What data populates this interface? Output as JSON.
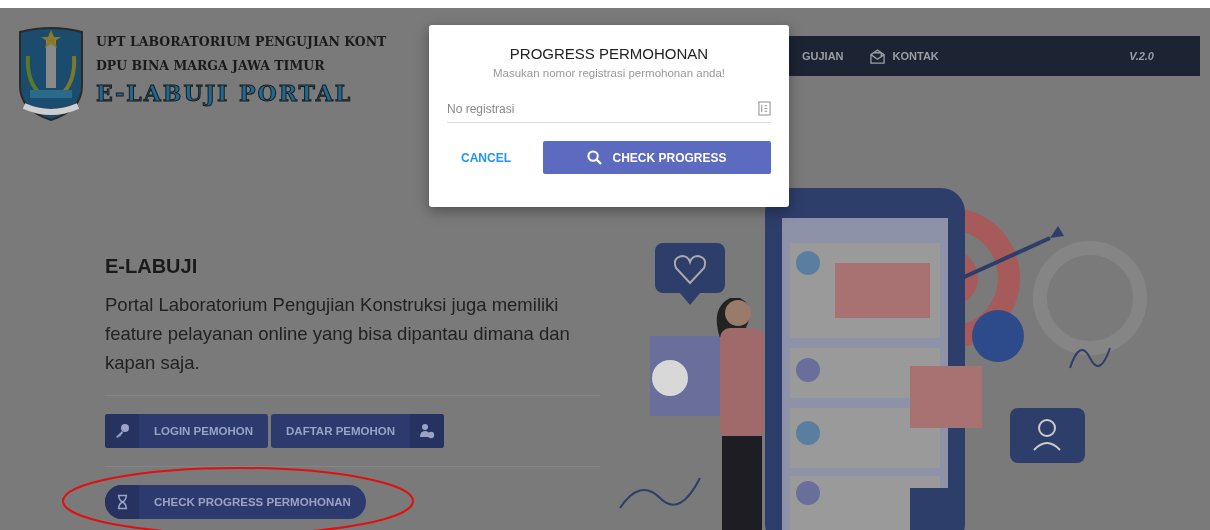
{
  "header": {
    "title_line_1": "UPT LABORATORIUM PENGUJIAN KONT",
    "title_line_2": "DPU BINA MARGA JAWA TIMUR",
    "portal_name": "E-LABUJI PORTAL"
  },
  "navbar": {
    "items": [
      {
        "label": "GUJIAN",
        "kind": "plain"
      },
      {
        "label": "KONTAK",
        "kind": "mail"
      }
    ],
    "version": "V.2.0"
  },
  "hero": {
    "title": "E-LABUJI",
    "description": "Portal Laboratorium Pengujian Konstruksi juga memiliki feature pelayanan online yang bisa dipantau dimana dan kapan saja.",
    "buttons": [
      {
        "label": "LOGIN PEMOHON",
        "kind": "login"
      },
      {
        "label": "DAFTAR PEMOHON",
        "kind": "register"
      }
    ],
    "progress_button": {
      "label": "CHECK PROGRESS PERMOHONAN"
    }
  },
  "dialog": {
    "title": "PROGRESS PERMOHONAN",
    "subtitle": "Masukan nomor registrasi permohonan anda!",
    "field": {
      "placeholder": "No registrasi"
    },
    "cancel": "CANCEL",
    "submit": "CHECK PROGRESS"
  }
}
